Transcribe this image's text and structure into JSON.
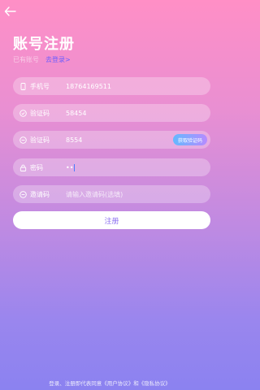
{
  "header": {
    "title": "账号注册"
  },
  "subtitle": {
    "text": "已有账号",
    "login_link": "去登录>"
  },
  "fields": [
    {
      "label": "手机号",
      "value": "18764169511",
      "icon": "phone-icon"
    },
    {
      "label": "验证码",
      "value": "58454",
      "icon": "verify-icon"
    },
    {
      "label": "验证码",
      "value": "8554",
      "icon": "verify-icon",
      "button": "获取验证码"
    },
    {
      "label": "密码",
      "value": "••",
      "icon": "lock-icon"
    },
    {
      "label": "邀请码",
      "value": "",
      "placeholder": "请输入邀请码(选填)",
      "icon": "verify-icon"
    }
  ],
  "submit": {
    "label": "注册"
  },
  "footer": {
    "text": "登录、注册即代表同意《用户协议》和《隐私协议》"
  }
}
